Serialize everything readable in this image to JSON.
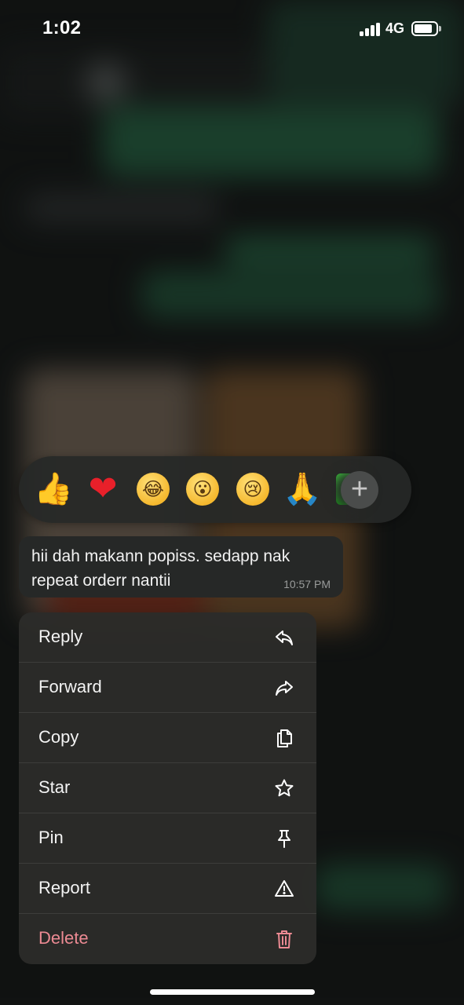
{
  "status_bar": {
    "time": "1:02",
    "network": "4G",
    "signal_bars": 4,
    "battery_level": 0.85
  },
  "reactions": [
    {
      "icon": "thumbs-up-emoji",
      "glyph": "👍"
    },
    {
      "icon": "red-heart-emoji",
      "glyph": "❤"
    },
    {
      "icon": "tears-of-joy-emoji",
      "glyph": "😂"
    },
    {
      "icon": "surprised-face-emoji",
      "glyph": "😮"
    },
    {
      "icon": "crying-face-emoji",
      "glyph": "😢"
    },
    {
      "icon": "folded-hands-emoji",
      "glyph": "🙏"
    },
    {
      "icon": "check-mark-emoji",
      "glyph": "✔"
    },
    {
      "icon": "plus-icon",
      "glyph": "+"
    }
  ],
  "message": {
    "text": "hii dah makann popiss. sedapp nak repeat orderr nantii",
    "time": "10:57 PM"
  },
  "menu": {
    "items": [
      {
        "label": "Reply",
        "icon": "reply-icon"
      },
      {
        "label": "Forward",
        "icon": "forward-icon"
      },
      {
        "label": "Copy",
        "icon": "copy-icon"
      },
      {
        "label": "Star",
        "icon": "star-icon"
      },
      {
        "label": "Pin",
        "icon": "pin-icon"
      },
      {
        "label": "Report",
        "icon": "warning-icon"
      },
      {
        "label": "Delete",
        "icon": "trash-icon"
      }
    ],
    "delete_color": "#ec8a93"
  },
  "colors": {
    "background": "#141615",
    "bubble": "#262827",
    "menu": "#2c2c2a",
    "accent_green": "#1f4a35"
  }
}
